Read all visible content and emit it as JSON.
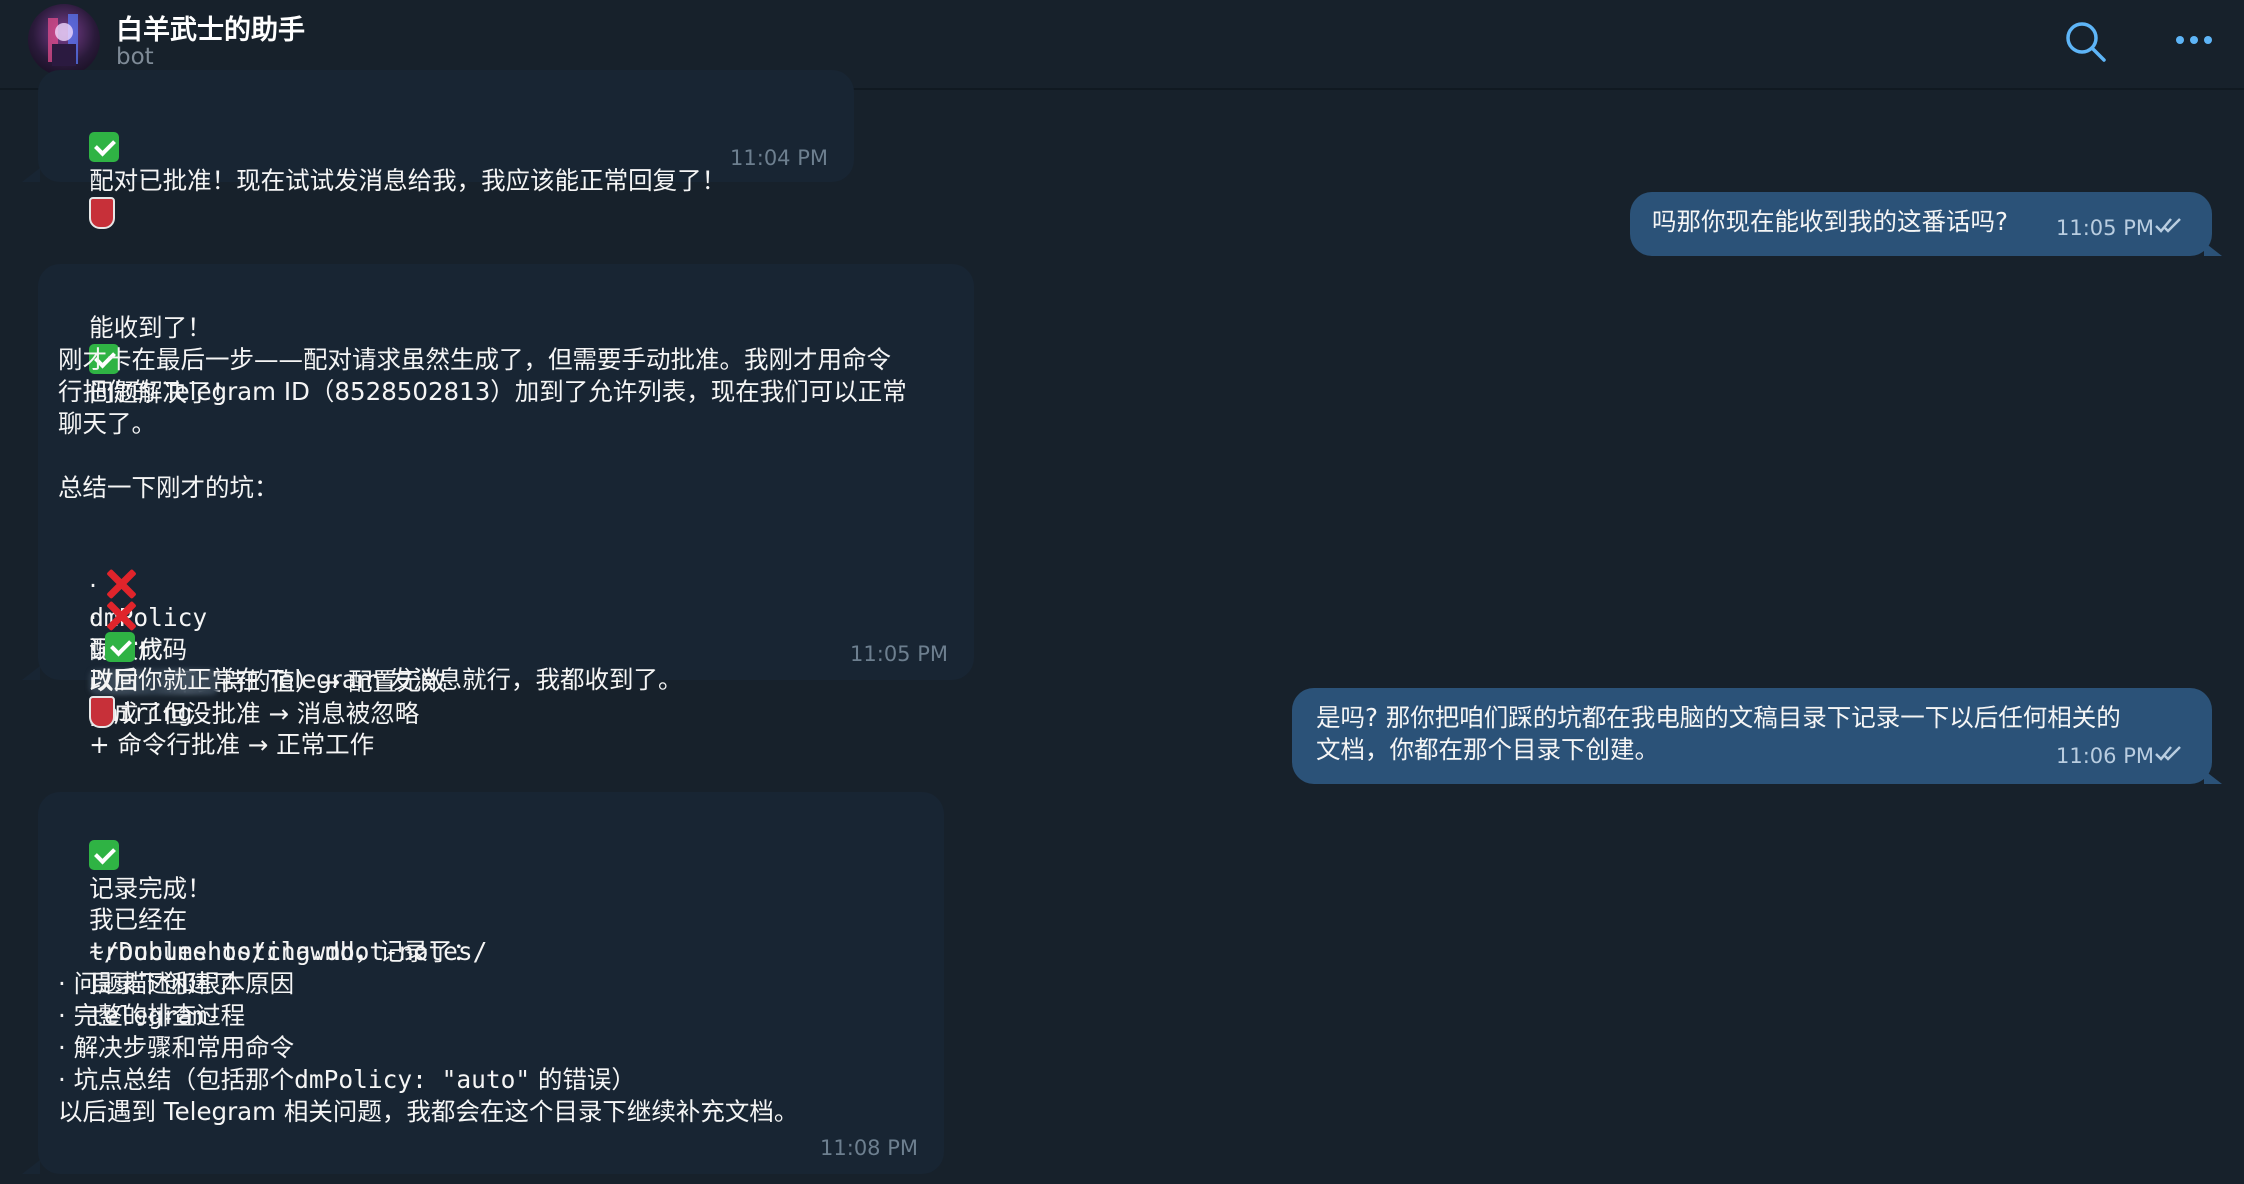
{
  "header": {
    "title": "白羊武士的助手",
    "subtitle": "bot",
    "search_icon": "search-icon",
    "menu_icon": "more-icon"
  },
  "messages": [
    {
      "dir": "in",
      "text": "配对已批准！现在试试发消息给我，我应该能正常回复了！",
      "time": "11:04 PM"
    },
    {
      "dir": "out",
      "text": "吗那你现在能收到我的这番话吗?",
      "time": "11:05 PM"
    },
    {
      "dir": "in",
      "lines": [
        "能收到了！",
        "问题解决了！",
        "刚才卡在最后一步——配对请求虽然生成了，但需要手动批准。我刚才用命令",
        "行把你的 Telegram ID（8528502813）加到了允许列表，现在我们可以正常",
        "聊天了。",
        "总结一下刚才的坑：",
        "dmPolicy",
        "误改成",
        "auto",
        "（不支持的值）→ 配置无效",
        "配对代码",
        "生成了但没批准 → 消息被忽略",
        "改回",
        "pairing",
        "+ 命令行批准 → 正常工作",
        "以后你就正常在 Telegram 发消息就行，我都收到了。"
      ],
      "time": "11:05 PM"
    },
    {
      "dir": "out",
      "lines": [
        "是吗? 那你把咱们踩的坑都在我电脑的文稿目录下记录一下以后任何相关的",
        "文档，你都在那个目录下创建。"
      ],
      "time": "11:06 PM"
    },
    {
      "dir": "in",
      "lines": [
        "记录完成！",
        "我已经在",
        "~/Documents/clawdbot-notes/",
        "目录下创建了",
        "telegram-",
        "troubleshooting.md",
        "，记录了：",
        "问题描述和根本原因",
        "完整的排查过程",
        "解决步骤和常用命令",
        "坑点总结（包括那个",
        "dmPolicy: \"auto\"",
        "的错误）",
        "以后遇到 Telegram 相关问题，我都会在这个目录下继续补充文档。"
      ],
      "time": "11:08 PM"
    }
  ],
  "colors": {
    "background": "#17212b",
    "incoming_bubble": "#182533",
    "outgoing_bubble": "#2b5278",
    "accent": "#5eb5f7"
  }
}
